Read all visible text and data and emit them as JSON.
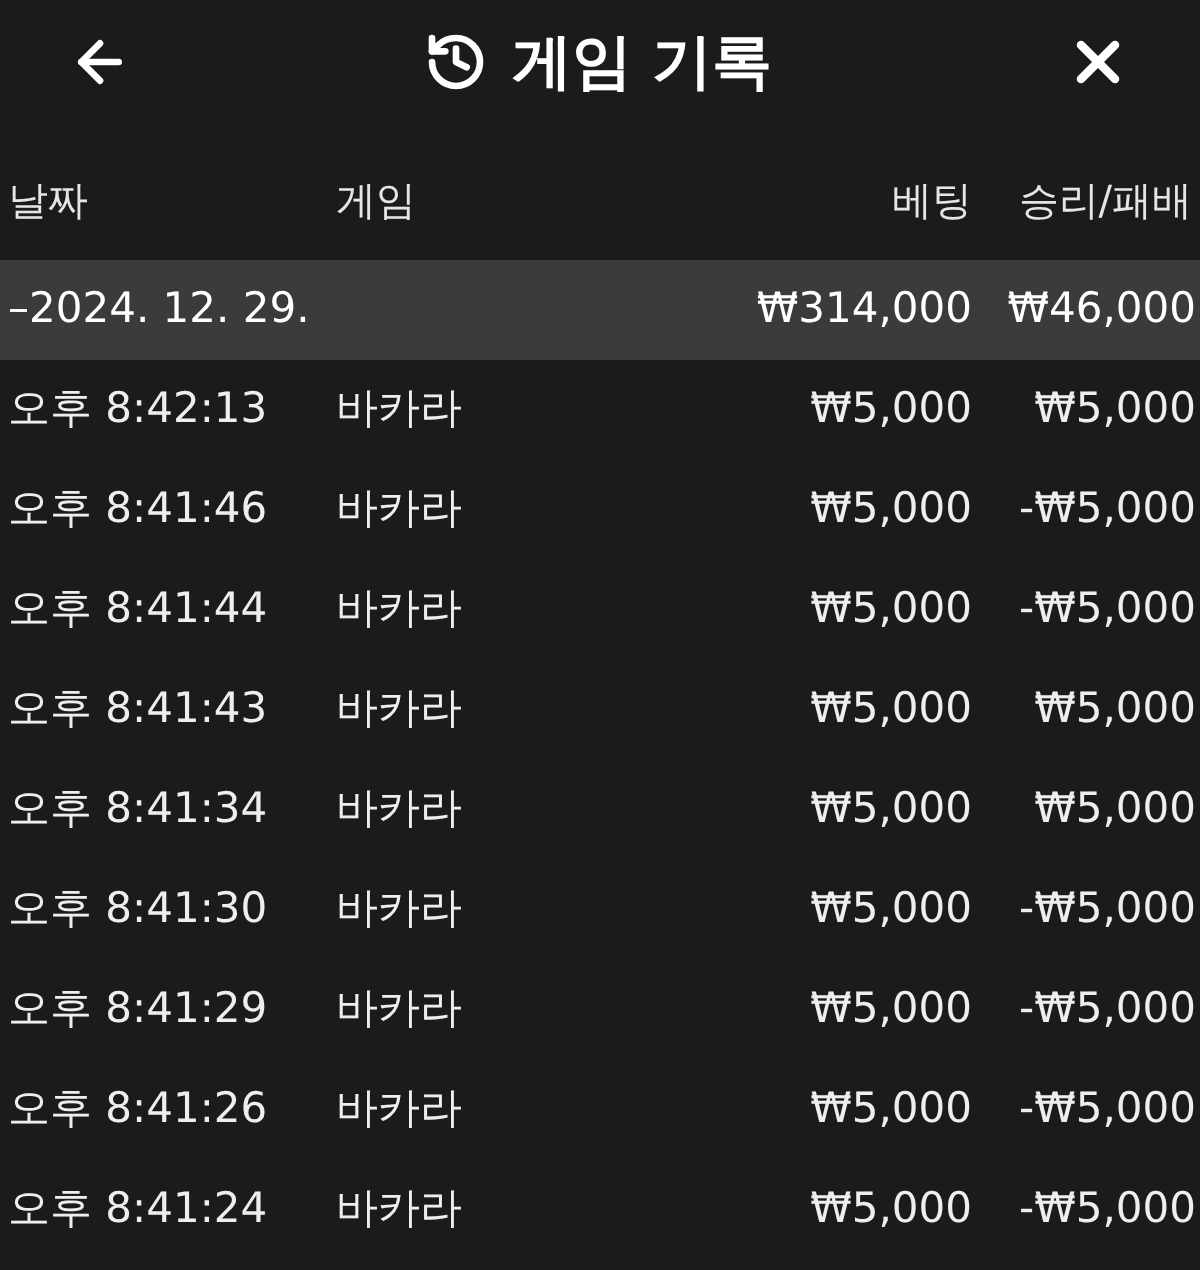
{
  "header": {
    "title": "게임 기록"
  },
  "table": {
    "columns": [
      "날짜",
      "게임",
      "베팅",
      "승리/패배"
    ],
    "group": {
      "date": "–2024. 12. 29.",
      "bet": "₩314,000",
      "result": "₩46,000"
    },
    "rows": [
      {
        "time": "오후 8:42:13",
        "game": "바카라",
        "bet": "₩5,000",
        "result": "₩5,000"
      },
      {
        "time": "오후 8:41:46",
        "game": "바카라",
        "bet": "₩5,000",
        "result": "-₩5,000"
      },
      {
        "time": "오후 8:41:44",
        "game": "바카라",
        "bet": "₩5,000",
        "result": "-₩5,000"
      },
      {
        "time": "오후 8:41:43",
        "game": "바카라",
        "bet": "₩5,000",
        "result": "₩5,000"
      },
      {
        "time": "오후 8:41:34",
        "game": "바카라",
        "bet": "₩5,000",
        "result": "₩5,000"
      },
      {
        "time": "오후 8:41:30",
        "game": "바카라",
        "bet": "₩5,000",
        "result": "-₩5,000"
      },
      {
        "time": "오후 8:41:29",
        "game": "바카라",
        "bet": "₩5,000",
        "result": "-₩5,000"
      },
      {
        "time": "오후 8:41:26",
        "game": "바카라",
        "bet": "₩5,000",
        "result": "-₩5,000"
      },
      {
        "time": "오후 8:41:24",
        "game": "바카라",
        "bet": "₩5,000",
        "result": "-₩5,000"
      }
    ]
  }
}
